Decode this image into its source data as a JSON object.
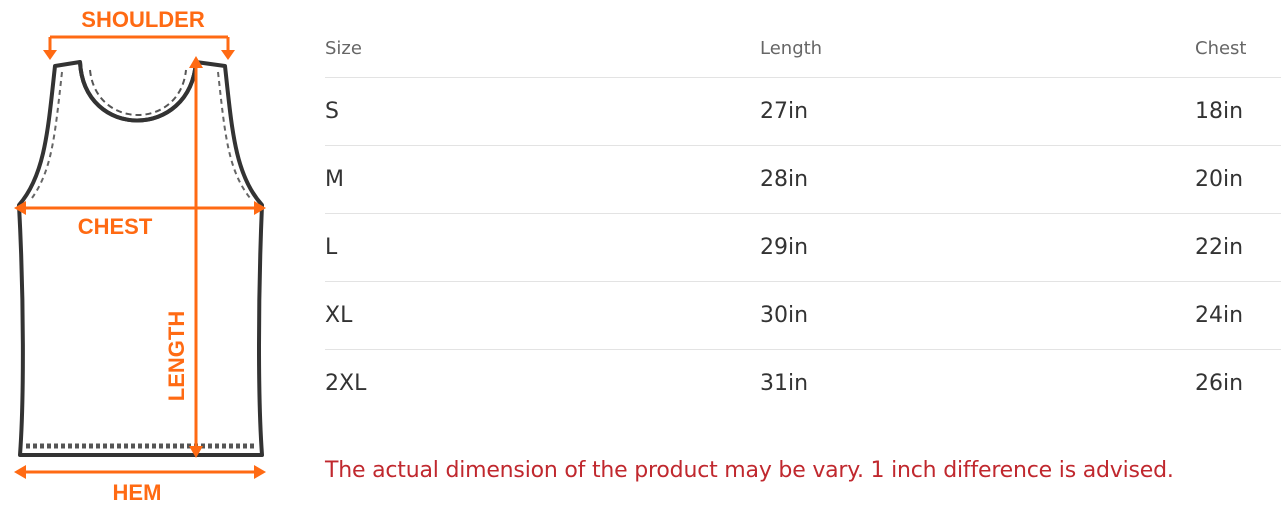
{
  "diagram": {
    "label_shoulder": "SHOULDER",
    "label_chest": "CHEST",
    "label_length": "LENGTH",
    "label_hem": "HEM",
    "accent_color": "#ff6a13"
  },
  "table": {
    "headers": [
      "Size",
      "Length",
      "Chest"
    ],
    "rows": [
      [
        "S",
        "27in",
        "18in"
      ],
      [
        "M",
        "28in",
        "20in"
      ],
      [
        "L",
        "29in",
        "22in"
      ],
      [
        "XL",
        "30in",
        "24in"
      ],
      [
        "2XL",
        "31in",
        "26in"
      ]
    ]
  },
  "note": "The actual dimension of the product may be vary. 1 inch difference is advised."
}
